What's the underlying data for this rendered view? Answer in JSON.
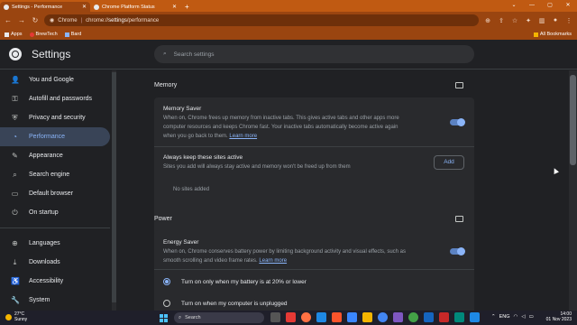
{
  "tabs": [
    {
      "label": "Settings - Performance",
      "active": true
    },
    {
      "label": "Chrome Platform Status",
      "active": false
    }
  ],
  "new_tab_label": "+",
  "window_controls": [
    "⌄",
    "—",
    "▢",
    "✕"
  ],
  "omnibox": {
    "site": "Chrome",
    "url_host": "chrome://",
    "url_path_bold": "settings",
    "url_rest": "/performance"
  },
  "bookmarks": {
    "items": [
      "Apps",
      "BrewTech",
      "Bard"
    ],
    "right": "All Bookmarks"
  },
  "header": {
    "title": "Settings",
    "search_placeholder": "Search settings"
  },
  "sidebar": {
    "items": [
      {
        "label": "You and Google",
        "icon": "person-icon"
      },
      {
        "label": "Autofill and passwords",
        "icon": "key-icon"
      },
      {
        "label": "Privacy and security",
        "icon": "shield-icon"
      },
      {
        "label": "Performance",
        "icon": "speedometer-icon",
        "selected": true
      },
      {
        "label": "Appearance",
        "icon": "palette-icon"
      },
      {
        "label": "Search engine",
        "icon": "search-icon"
      },
      {
        "label": "Default browser",
        "icon": "browser-icon"
      },
      {
        "label": "On startup",
        "icon": "power-icon"
      }
    ],
    "items2": [
      {
        "label": "Languages",
        "icon": "globe-icon"
      },
      {
        "label": "Downloads",
        "icon": "download-icon"
      },
      {
        "label": "Accessibility",
        "icon": "accessibility-icon"
      },
      {
        "label": "System",
        "icon": "wrench-icon"
      }
    ]
  },
  "memory": {
    "heading": "Memory",
    "saver_title": "Memory Saver",
    "saver_desc_1": "When on, Chrome frees up memory from inactive tabs. This gives active tabs and other apps more",
    "saver_desc_2": "computer resources and keeps Chrome fast. Your inactive tabs automatically become active again",
    "saver_desc_3": "when you go back to them.",
    "learn_more": "Learn more",
    "saver_enabled": true,
    "active_title": "Always keep these sites active",
    "active_desc": "Sites you add will always stay active and memory won't be freed up from them",
    "add_label": "Add",
    "no_sites": "No sites added"
  },
  "power": {
    "heading": "Power",
    "saver_title": "Energy Saver",
    "saver_desc_1": "When on, Chrome conserves battery power by limiting background activity and visual effects, such as",
    "saver_desc_2": "smooth scrolling and video frame rates.",
    "learn_more": "Learn more",
    "saver_enabled": true,
    "option_1": "Turn on only when my battery is at 20% or lower",
    "option_2": "Turn on when my computer is unplugged"
  },
  "taskbar": {
    "temp": "27°C",
    "weather": "Sunny",
    "search": "Search",
    "lang": "ENG",
    "time": "14:00",
    "date": "01 Nov 2023"
  },
  "colors": {
    "accent": "#8ab4f8",
    "titlebar": "#c05a12",
    "toolbar": "#9a4510"
  }
}
